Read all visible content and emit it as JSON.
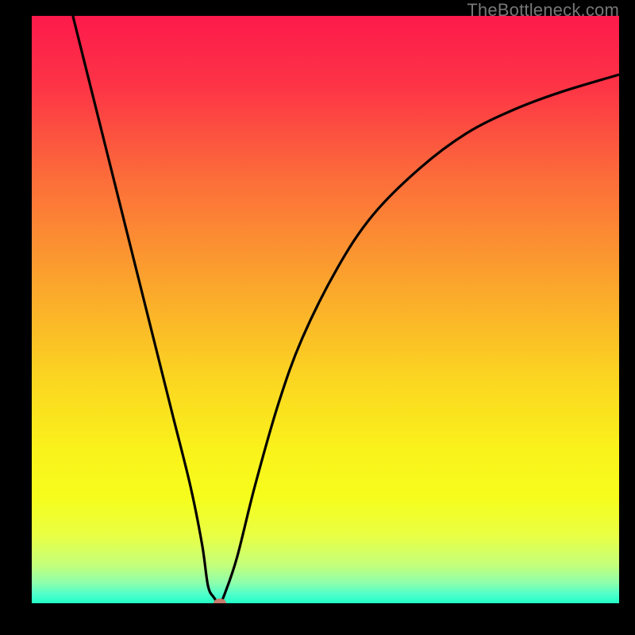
{
  "watermark": "TheBottleneck.com",
  "colors": {
    "gradient_stops": [
      {
        "offset": 0.0,
        "color": "#fd1a4b"
      },
      {
        "offset": 0.12,
        "color": "#fd3446"
      },
      {
        "offset": 0.28,
        "color": "#fc6e3a"
      },
      {
        "offset": 0.45,
        "color": "#fba32d"
      },
      {
        "offset": 0.62,
        "color": "#fbd621"
      },
      {
        "offset": 0.74,
        "color": "#faf21b"
      },
      {
        "offset": 0.82,
        "color": "#f6fd1c"
      },
      {
        "offset": 0.885,
        "color": "#e9ff44"
      },
      {
        "offset": 0.935,
        "color": "#c4ff7b"
      },
      {
        "offset": 0.965,
        "color": "#8effab"
      },
      {
        "offset": 0.985,
        "color": "#4effcb"
      },
      {
        "offset": 1.0,
        "color": "#22ffc7"
      }
    ],
    "curve": "#000000",
    "marker": "#c77b6b",
    "frame": "#000000"
  },
  "chart_data": {
    "type": "line",
    "title": "",
    "xlabel": "",
    "ylabel": "",
    "xlim": [
      0,
      100
    ],
    "ylim": [
      0,
      100
    ],
    "series": [
      {
        "name": "bottleneck-curve",
        "x": [
          7,
          10,
          15,
          20,
          24,
          27,
          29,
          30,
          31,
          32,
          33,
          35,
          38,
          42,
          46,
          52,
          58,
          66,
          74,
          82,
          90,
          100
        ],
        "y": [
          100,
          88,
          68,
          48,
          32,
          20,
          10,
          3,
          1,
          0,
          2,
          8,
          20,
          34,
          45,
          57,
          66,
          74,
          80,
          84,
          87,
          90
        ]
      }
    ],
    "marker": {
      "x": 32,
      "y": 0
    },
    "grid": false,
    "legend": false
  }
}
